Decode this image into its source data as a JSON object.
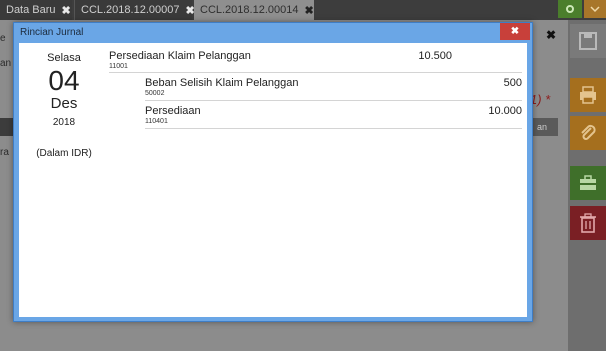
{
  "background": {
    "tabs": [
      {
        "label": "Data Baru",
        "close": "✖"
      },
      {
        "label": "CCL.2018.12.00007",
        "close": "✖"
      },
      {
        "label": "CCL.2018.12.00014",
        "close": "✖"
      }
    ],
    "fragment_e": "e",
    "fragment_an": "an",
    "fragment_ra": "ra",
    "fragment_an2": "an",
    "fragment_red": "1) *",
    "close_x": "✖"
  },
  "modal": {
    "title": "Rincian Jurnal",
    "close": "✖",
    "date": {
      "day_name": "Selasa",
      "day": "04",
      "month": "Des",
      "year": "2018",
      "currency_note": "(Dalam IDR)"
    },
    "entries": [
      {
        "account": "Persediaan Klaim Pelanggan",
        "code": "11001",
        "debit": "10.500",
        "credit": ""
      },
      {
        "account": "Beban Selisih Klaim Pelanggan",
        "code": "50002",
        "debit": "",
        "credit": "500"
      },
      {
        "account": "Persediaan",
        "code": "110401",
        "debit": "",
        "credit": "10.000"
      }
    ]
  },
  "colors": {
    "modal_border": "#6aa6e6",
    "close_red": "#c8403a",
    "side_orange": "#a56f1e",
    "side_green": "#3f6f2a",
    "side_red": "#7a1f24"
  }
}
